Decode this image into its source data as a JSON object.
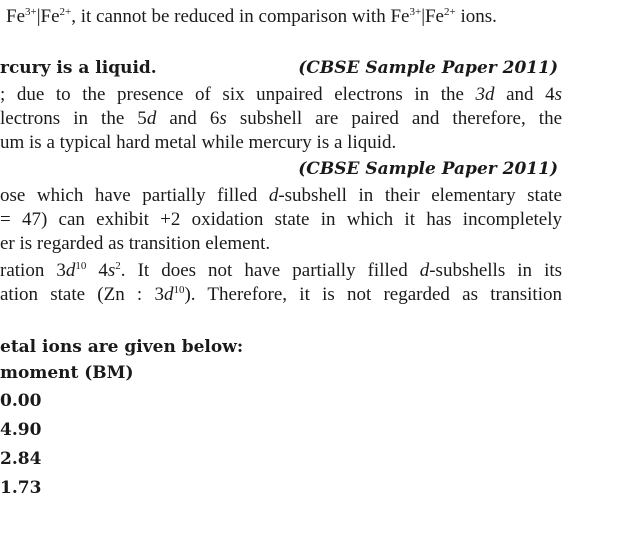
{
  "doc": {
    "l1_a": "Fe",
    "l1_sup1": "3+",
    "l1_b": "|Fe",
    "l1_sup2": "2+",
    "l1_c": ", it cannot be reduced in comparison with Fe",
    "l1_sup3": "3+",
    "l1_d": "|Fe",
    "l1_sup4": "2+",
    "l1_e": " ions.",
    "heading1": "rcury is a liquid.",
    "ref1": "(CBSE Sample Paper 2011)",
    "p1_l1_a": "; due to the presence of six unpaired electrons in the ",
    "p1_l1_b": "3d",
    "p1_l1_c": " and 4",
    "p1_l1_d": "s",
    "p1_l2_a": "lectrons in the 5",
    "p1_l2_b": "d",
    "p1_l2_c": " and 6",
    "p1_l2_d": "s",
    "p1_l2_e": " subshell are paired and therefore, the",
    "p1_l3": "um is a typical hard metal while mercury is a liquid.",
    "ref2": "(CBSE Sample Paper 2011)",
    "p2_l1_a": "ose which have partially filled ",
    "p2_l1_b": "d",
    "p2_l1_c": "-subshell in their elementary state",
    "p2_l2": "= 47) can exhibit +2 oxidation state in which it has incompletely",
    "p2_l3": "er is regarded as transition element.",
    "p3_l1_a": "ration 3",
    "p3_l1_b": "d",
    "p3_l1_sup1": "10",
    "p3_l1_c": " 4",
    "p3_l1_d": "s",
    "p3_l1_sup2": "2",
    "p3_l1_e": ". It does not have partially filled ",
    "p3_l1_f": "d",
    "p3_l1_g": "-subshells in its",
    "p3_l2_a": "ation state (Zn : 3",
    "p3_l2_b": "d",
    "p3_l2_sup": "10",
    "p3_l2_c": "). Therefore, it is not regarded as transition",
    "heading2": "etal ions are given below:",
    "heading3": "moment (BM)",
    "values": [
      "0.00",
      "4.90",
      "2.84",
      "1.73"
    ]
  }
}
